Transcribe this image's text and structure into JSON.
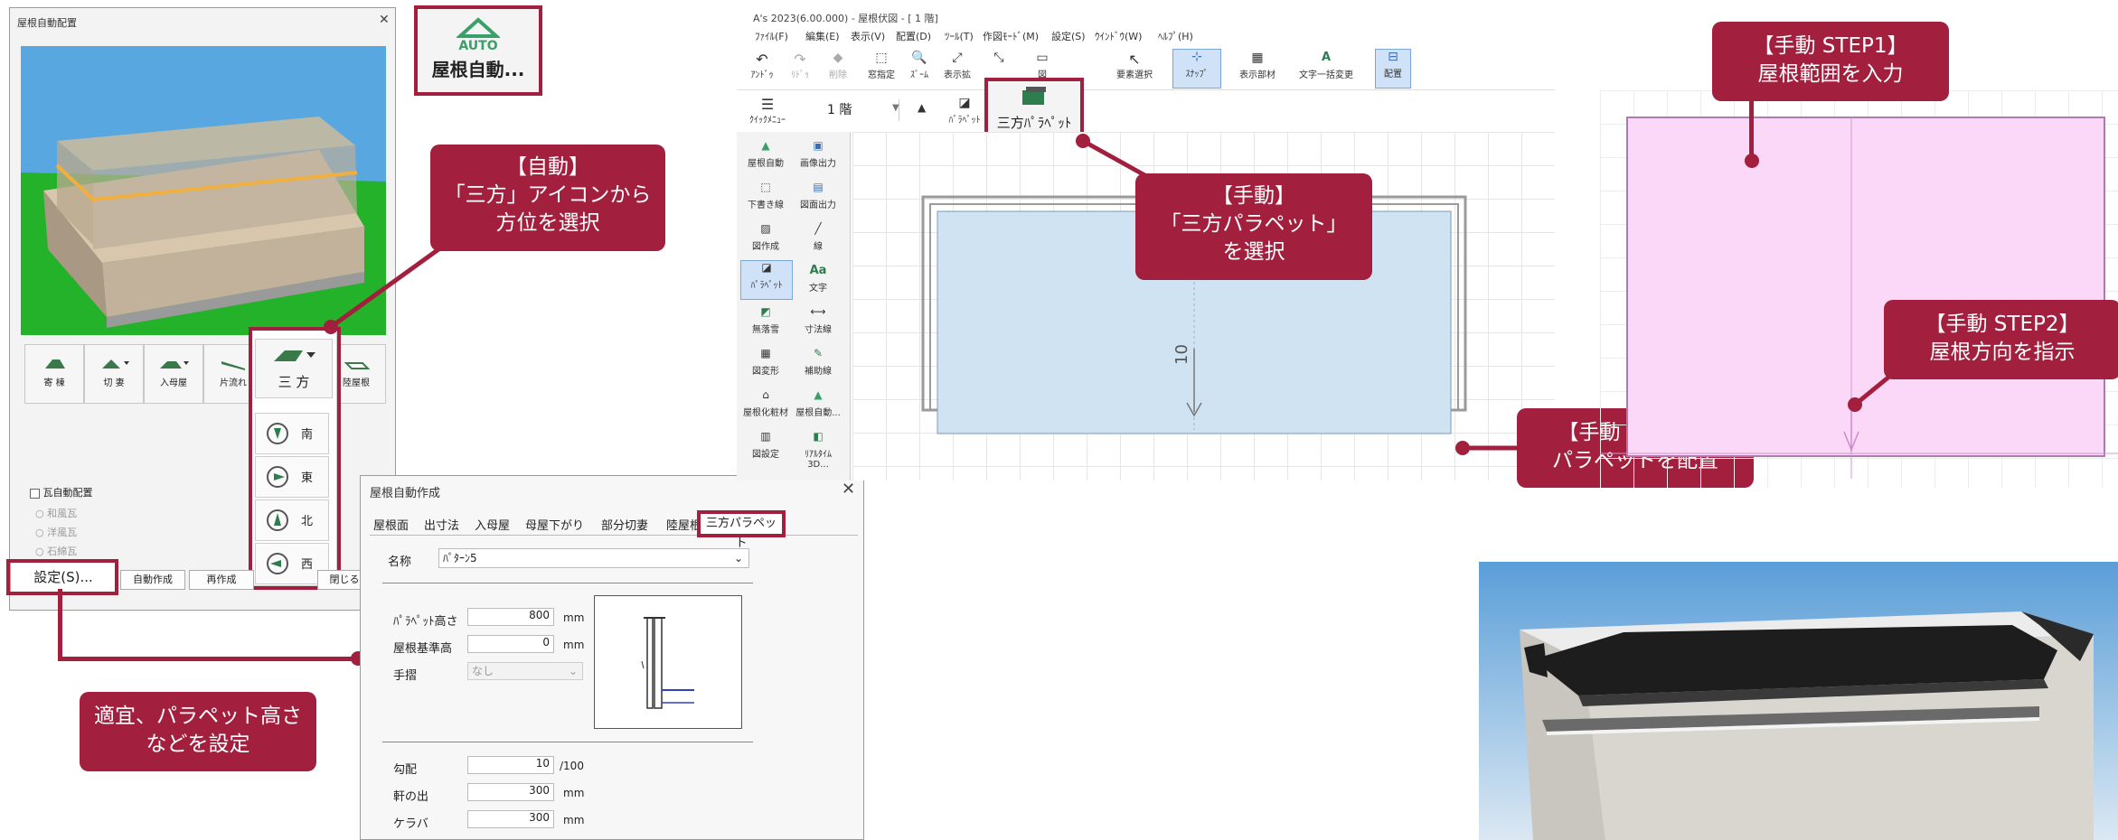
{
  "left_dialog": {
    "title": "屋根自動配置",
    "roof_types": [
      "寄 棟",
      "切 妻",
      "入母屋",
      "片流れ",
      "三 方",
      "陸屋根"
    ],
    "directions": [
      "南",
      "東",
      "北",
      "西"
    ],
    "tile_section_label": "瓦自動配置",
    "tile_options": [
      "和風瓦",
      "洋風瓦",
      "石綿瓦"
    ],
    "settings_button": "設定(S)...",
    "auto_create_button": "自動作成",
    "recreate_button": "再作成",
    "close_button": "閉じる"
  },
  "auto_icon": {
    "badge": "AUTO",
    "label": "屋根自動..."
  },
  "create_dialog": {
    "title": "屋根自動作成",
    "tabs": [
      "屋根面",
      "出寸法",
      "入母屋",
      "母屋下がり",
      "部分切妻",
      "陸屋根",
      "三方パラペット"
    ],
    "name_label": "名称",
    "name_value": "ﾊﾟﾀｰﾝ5",
    "parapet_height_label": "ﾊﾟﾗﾍﾟｯﾄ高さ",
    "parapet_height_value": "800",
    "roof_base_label": "屋根基準高",
    "roof_base_value": "0",
    "handrail_label": "手摺",
    "handrail_value": "なし",
    "slope_label": "勾配",
    "slope_value": "10",
    "slope_unit": "/100",
    "eave_label": "軒の出",
    "eave_value": "300",
    "keraba_label": "ケラバ",
    "keraba_value": "300",
    "mm": "mm"
  },
  "cad_window": {
    "title": "A's 2023(6.00.000) - 屋根伏図 - [ 1 階]",
    "menus": [
      "ﾌｧｲﾙ(F)",
      "編集(E)",
      "表示(V)",
      "配置(D)",
      "ﾂｰﾙ(T)",
      "作図ﾓｰﾄﾞ(M)",
      "設定(S)",
      "ｳｲﾝﾄﾞｳ(W)",
      "ﾍﾙﾌﾟ(H)"
    ],
    "toolbar": [
      "ｱﾝﾄﾞｩ",
      "ﾘﾄﾞｩ",
      "削除",
      "窓指定",
      "ｽﾞｰﾑ",
      "表示拡",
      "",
      "図",
      "要素選択",
      "ｽﾅｯﾌﾟ",
      "表示部材",
      "文字一括変更",
      "配置"
    ],
    "quick_menu": "ｸｲｯｸﾒﾆｭｰ",
    "floor_select": "1 階",
    "parapet_tool": "ﾊﾟﾗﾍﾟｯﾄ",
    "highlight_tool": "三方ﾊﾟﾗﾍﾟｯﾄ",
    "sidebar": [
      "屋根自動",
      "画像出力",
      "下書き線",
      "図面出力",
      "図作成",
      "線",
      "ﾊﾟﾗﾍﾟｯﾄ",
      "文字",
      "無落雪",
      "寸法線",
      "図変形",
      "補助線",
      "屋根化粧材",
      "屋根自動...",
      "図設定",
      "ﾘｱﾙﾀｲﾑ3D..."
    ],
    "slope_mark": "10"
  },
  "callouts": {
    "auto": [
      "【自動】",
      "「三方」アイコンから",
      "方位を選択"
    ],
    "manual": [
      "【手動】",
      "「三方パラペット」",
      "を選択"
    ],
    "settings": [
      "適宜、パラペット高さ",
      "などを設定"
    ],
    "step1": [
      "【手動 STEP1】",
      "屋根範囲を入力"
    ],
    "step2": [
      "【手動 STEP2】",
      "屋根方向を指示"
    ],
    "step3": [
      "【手動 STEP3】",
      "パラペットを配置"
    ]
  },
  "colors": {
    "accent": "#a21f3e",
    "auto_green": "#3aa06a",
    "plan_fill": "#cfe3f3",
    "step_fill": "#fbd8f7"
  }
}
